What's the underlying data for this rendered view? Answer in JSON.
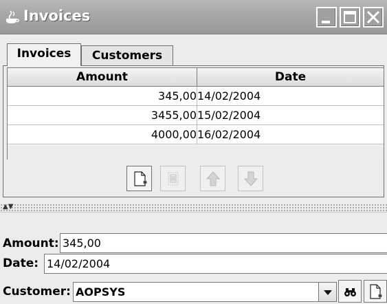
{
  "window": {
    "title": "Invoices"
  },
  "tabs": [
    {
      "label": "Invoices",
      "active": true
    },
    {
      "label": "Customers",
      "active": false
    }
  ],
  "table": {
    "columns": [
      "Amount",
      "Date"
    ],
    "rows": [
      {
        "amount": "345,00",
        "date": "14/02/2004"
      },
      {
        "amount": "3455,00",
        "date": "15/02/2004"
      },
      {
        "amount": "4000,00",
        "date": "16/02/2004"
      }
    ]
  },
  "toolbar": {
    "buttons": [
      {
        "icon": "new-document-icon",
        "enabled": true
      },
      {
        "icon": "delete-trash-icon",
        "enabled": false
      },
      {
        "icon": "arrow-up-icon",
        "enabled": false
      },
      {
        "icon": "arrow-down-icon",
        "enabled": false
      }
    ]
  },
  "form": {
    "amount_label": "Amount:",
    "amount_value": "345,00",
    "date_label": "Date:",
    "date_value": "14/02/2004",
    "customer_label": "Customer:",
    "customer_value": "AOPSYS"
  },
  "colors": {
    "title_bar": "#a8a8a8",
    "background": "#ececec"
  }
}
